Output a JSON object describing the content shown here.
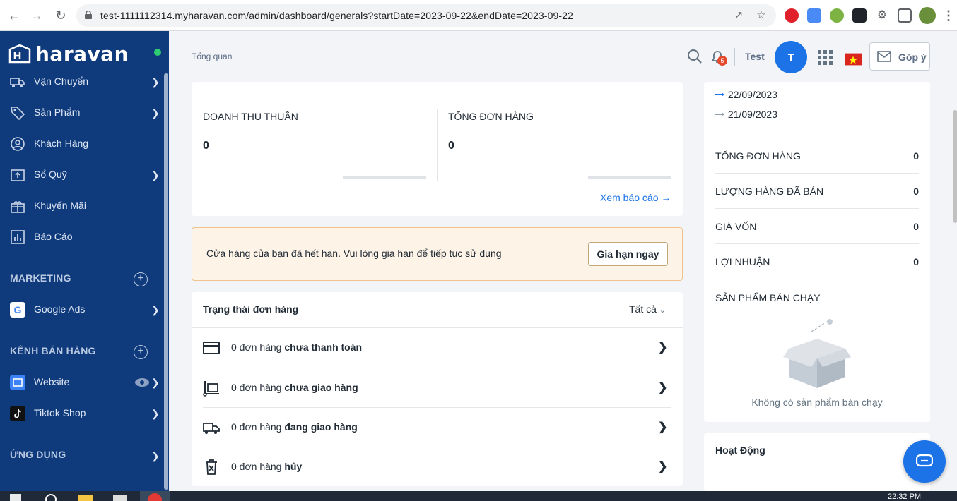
{
  "browser": {
    "url": "test-1111112314.myharavan.com/admin/dashboard/generals?startDate=2023-09-22&endDate=2023-09-22",
    "back_icon": "arrow-left-icon",
    "forward_icon": "arrow-right-icon",
    "reload_icon": "reload-icon"
  },
  "sidebar": {
    "logo_text": "haravan",
    "items": [
      {
        "label": "Vận Chuyển",
        "icon": "truck-icon",
        "has_chevron": true
      },
      {
        "label": "Sản Phẩm",
        "icon": "tag-icon",
        "has_chevron": true
      },
      {
        "label": "Khách Hàng",
        "icon": "user-circle-icon",
        "has_chevron": false
      },
      {
        "label": "Sổ Quỹ",
        "icon": "cashbook-icon",
        "has_chevron": true
      },
      {
        "label": "Khuyến Mãi",
        "icon": "gift-icon",
        "has_chevron": false
      },
      {
        "label": "Báo Cáo",
        "icon": "report-icon",
        "has_chevron": false
      }
    ],
    "marketing_section": "MARKETING",
    "marketing_items": [
      {
        "label": "Google Ads",
        "icon": "google-icon"
      }
    ],
    "sales_section": "KÊNH BÁN HÀNG",
    "sales_items": [
      {
        "label": "Website",
        "icon": "website-icon"
      },
      {
        "label": "Tiktok Shop",
        "icon": "tiktok-icon"
      }
    ],
    "apps_section": "ỨNG DỤNG"
  },
  "header": {
    "breadcrumb": "Tổng quan",
    "notification_count": "5",
    "user_name": "Test",
    "avatar_initial": "T",
    "feedback_label": "Góp ý"
  },
  "kpi": {
    "revenue_label": "DOANH THU THUẦN",
    "revenue_value": "0",
    "orders_label": "TỔNG ĐƠN HÀNG",
    "orders_value": "0",
    "report_link": "Xem báo cáo"
  },
  "banner": {
    "message": "Cửa hàng của bạn đã hết hạn. Vui lòng gia hạn để tiếp tục sử dụng",
    "button": "Gia hạn ngay"
  },
  "order_status": {
    "title": "Trạng thái đơn hàng",
    "filter": "Tất cả",
    "rows": [
      {
        "prefix": "0 đơn hàng ",
        "bold": "chưa thanh toán",
        "icon": "credit-card-icon"
      },
      {
        "prefix": "0 đơn hàng ",
        "bold": "chưa giao hàng",
        "icon": "trolley-icon"
      },
      {
        "prefix": "0 đơn hàng ",
        "bold": "đang giao hàng",
        "icon": "delivery-truck-icon"
      },
      {
        "prefix": "0 đơn hàng ",
        "bold": "hủy",
        "icon": "cancel-bin-icon"
      }
    ]
  },
  "right_panel": {
    "legend": [
      {
        "date": "22/09/2023",
        "color": "#1c73e8"
      },
      {
        "date": "21/09/2023",
        "color": "#919eab"
      }
    ],
    "stats": [
      {
        "label": "TỔNG ĐƠN HÀNG",
        "value": "0"
      },
      {
        "label": "LƯỢNG HÀNG ĐÃ BÁN",
        "value": "0"
      },
      {
        "label": "GIÁ VỐN",
        "value": "0"
      },
      {
        "label": "LỢI NHUẬN",
        "value": "0"
      }
    ],
    "top_products_title": "SẢN PHẨM BÁN CHẠY",
    "empty_text": "Không có sản phẩm bán chạy",
    "activity_title": "Hoạt Động"
  },
  "taskbar": {
    "clock": "22:32 PM"
  }
}
